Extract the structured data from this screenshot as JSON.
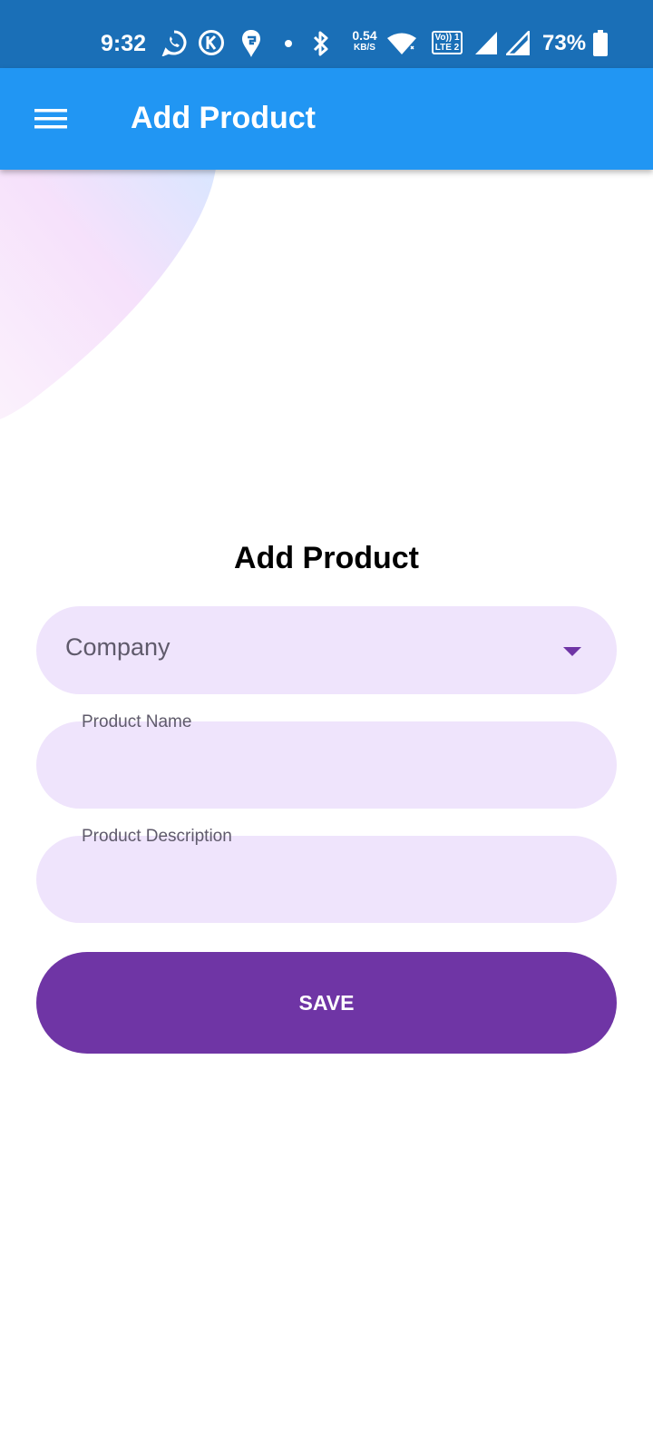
{
  "status_bar": {
    "time": "9:32",
    "net_speed_value": "0.54",
    "net_speed_unit": "KB/S",
    "volte_top": "Vo)) 1",
    "volte_bottom": "LTE 2",
    "battery_percent": "73%",
    "icons": [
      "whatsapp-icon",
      "k-app-icon",
      "swiggy-icon",
      "dot-icon",
      "bluetooth-icon",
      "wifi-icon",
      "volte-icon",
      "signal-icon",
      "signal-icon",
      "battery-icon"
    ]
  },
  "app_bar": {
    "title": "Add Product",
    "menu_icon": "hamburger-menu-icon",
    "background": "#2196f3"
  },
  "form": {
    "title": "Add Product",
    "company_select": {
      "value": "Company",
      "icon": "dropdown-arrow-icon"
    },
    "product_name": {
      "label": "Product Name",
      "value": ""
    },
    "product_description": {
      "label": "Product Description",
      "value": ""
    },
    "save_label": "SAVE"
  },
  "colors": {
    "status_bar": "#1a6fb7",
    "app_bar": "#2196f3",
    "field_fill": "#efe4fc",
    "accent": "#6f35a5"
  }
}
